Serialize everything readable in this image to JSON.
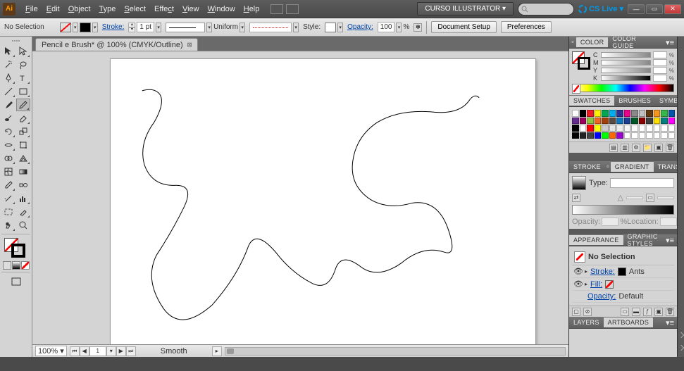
{
  "menu": {
    "items": [
      "File",
      "Edit",
      "Object",
      "Type",
      "Select",
      "Effect",
      "View",
      "Window",
      "Help"
    ]
  },
  "workspace_label": "CURSO ILLUSTRATOR ▾",
  "cslive": "CS Live ▾",
  "control": {
    "selection": "No Selection",
    "stroke_label": "Stroke:",
    "stroke_pt": "1 pt",
    "uniform": "Uniform",
    "style_label": "Style:",
    "opacity_label": "Opacity:",
    "opacity_val": "100",
    "pct": "%",
    "doc_setup": "Document Setup",
    "prefs": "Preferences"
  },
  "doc_tab": "Pencil e Brush* @ 100% (CMYK/Outline)",
  "status": {
    "zoom": "100%",
    "artboard": "1",
    "tool": "Smooth"
  },
  "panels": {
    "color": {
      "tab1": "Color",
      "tab2": "Color Guide",
      "channels": [
        "C",
        "M",
        "Y",
        "K"
      ]
    },
    "swatches": {
      "tab1": "Swatches",
      "tab2": "Brushes",
      "tab3": "Symbols",
      "colors": [
        "#ffffff",
        "#000000",
        "#ed1c24",
        "#fff200",
        "#00a651",
        "#00aeef",
        "#2e3192",
        "#ec008c",
        "#898989",
        "#c0c0c0",
        "#603913",
        "#f7941d",
        "#39b54a",
        "#0054a6",
        "#662d91",
        "#9e005d",
        "#8dc63f",
        "#f26522",
        "#a0410d",
        "#594a42",
        "#0f75bc",
        "#1c3f94",
        "#005826",
        "#8b0000",
        "#404040",
        "#ffde00",
        "#008080",
        "#ff00ff",
        "#000000",
        "#ffffff",
        "#ff0000",
        "#ffff00",
        "#cccccc",
        "#e5e5e5",
        "#eeeeee",
        "#f5f5f5",
        "#fafafa",
        "#ffffff",
        "#ffffff",
        "#ffffff",
        "#ffffff",
        "#ffffff",
        "#000000",
        "#222222",
        "#444444",
        "#0000ff",
        "#00ff00",
        "#ff6600",
        "#9900cc",
        "#ffffff",
        "#ffffff",
        "#ffffff",
        "#ffffff",
        "#ffffff",
        "#ffffff",
        "#ffffff"
      ]
    },
    "gradient": {
      "tab1": "Stroke",
      "tab2": "Gradient",
      "tab3": "Transpa",
      "type_label": "Type:",
      "opacity_label": "Opacity:",
      "location_label": "Location:"
    },
    "appearance": {
      "tab1": "Appearance",
      "tab2": "Graphic Styles",
      "title": "No Selection",
      "stroke": "Stroke:",
      "stroke_val": "Ants",
      "fill": "Fill:",
      "opacity": "Opacity:",
      "opacity_val": "Default"
    },
    "layers": {
      "tab1": "Layers",
      "tab2": "Artboards"
    }
  }
}
